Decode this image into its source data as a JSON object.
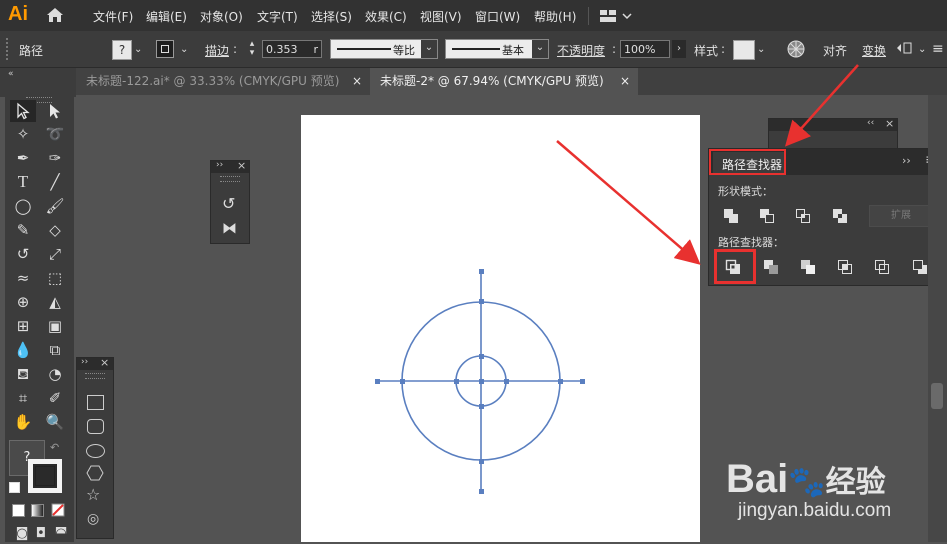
{
  "app": {
    "logo": "Ai"
  },
  "menu": [
    "文件(F)",
    "编辑(E)",
    "对象(O)",
    "文字(T)",
    "选择(S)",
    "效果(C)",
    "视图(V)",
    "窗口(W)",
    "帮助(H)"
  ],
  "control": {
    "selection_label": "路径",
    "fill_value": "?",
    "stroke_label": "描边",
    "stroke_value": "0.353",
    "stroke_unit": "r",
    "profile1": "等比",
    "profile2": "基本",
    "opacity_label": "不透明度",
    "opacity_value": "100%",
    "style_label": "样式",
    "align_label": "对齐",
    "transform_label": "变换"
  },
  "tabs": [
    {
      "title": "未标题-122.ai* @ 33.33% (CMYK/GPU 预览)",
      "close": "×",
      "active": false
    },
    {
      "title": "未标题-2* @ 67.94% (CMYK/GPU 预览)",
      "close": "×",
      "active": true
    }
  ],
  "toolbar": {
    "fill_unknown": "?"
  },
  "pathfinder": {
    "title": "路径查找器",
    "shape_modes_label": "形状模式：",
    "expand_label": "扩展",
    "pathfinders_label": "路径查找器："
  },
  "watermark": {
    "logo": "Bai🐾经验",
    "logo_text": "Bai",
    "logo_cn": "经验",
    "url": "jingyan.baidu.com"
  },
  "colors": {
    "accent_red": "#e8312f",
    "circle_blue": "#5a7fc0",
    "ui_dark": "#323232"
  }
}
